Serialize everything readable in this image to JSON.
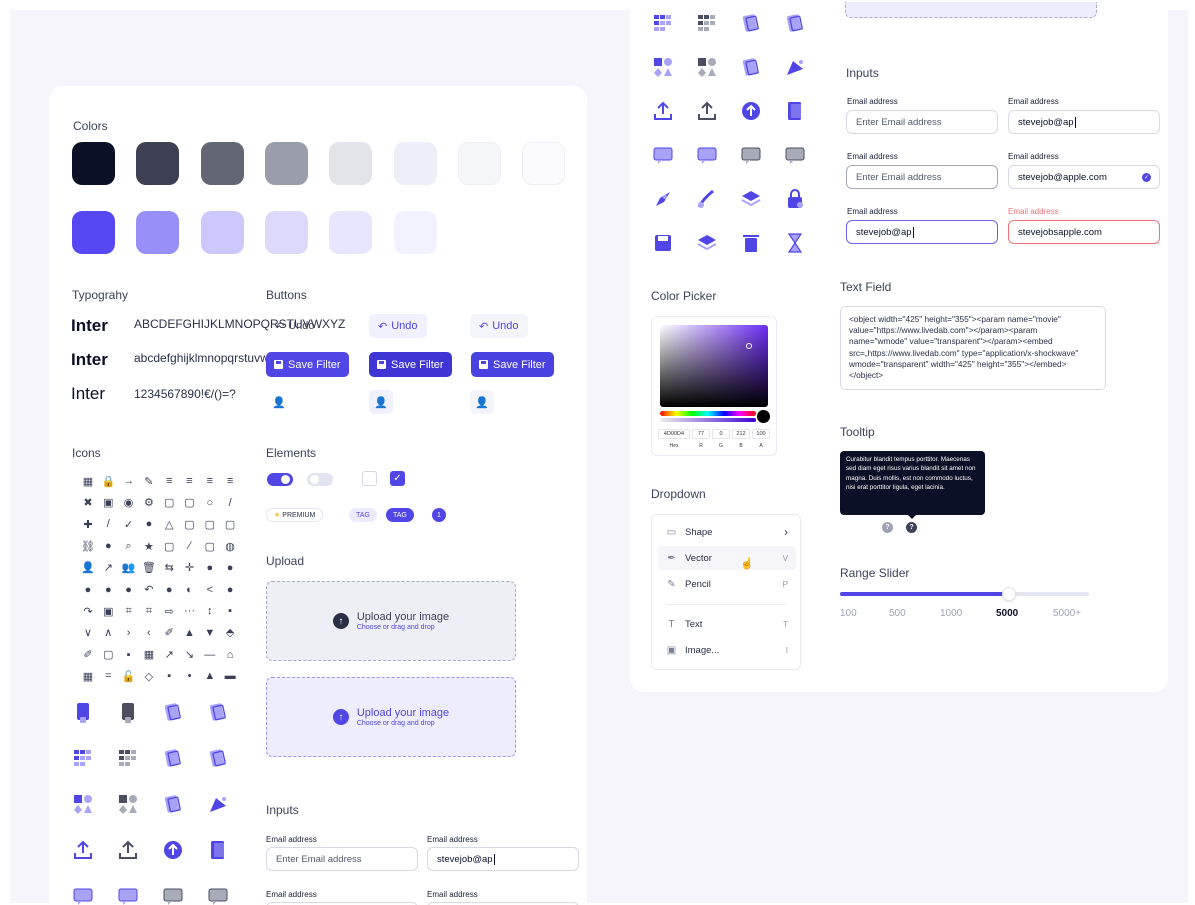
{
  "colors": {
    "title": "Colors",
    "row1": [
      "#0b1026",
      "#3c4052",
      "#626675",
      "#9a9dab",
      "#e2e4ea",
      "#eceff6",
      "#f5f6fa",
      "#fbfbfd"
    ],
    "row2": [
      "#5548f2",
      "#988ff8",
      "#cdc8fc",
      "#ddd9fd",
      "#e8e6fe",
      "#f2f1ff"
    ]
  },
  "typography": {
    "title": "Typograhy",
    "samples": [
      {
        "font": "Inter",
        "text": "ABCDEFGHIJKLMNOPQRSTUVWXYZ"
      },
      {
        "font": "Inter",
        "text": "abcdefghijklmnopqrstuvwxyz"
      },
      {
        "font": "Inter",
        "text": "1234567890!€/()=?"
      }
    ]
  },
  "buttons": {
    "title": "Buttons",
    "undo_label": "Undo",
    "save_label": "Save Filter"
  },
  "icons": {
    "title": "Icons"
  },
  "elements": {
    "title": "Elements",
    "premium": "PREMIUM",
    "tag": "TAG",
    "count": "1"
  },
  "upload": {
    "title": "Upload",
    "heading": "Upload your image",
    "sub": "Choose or drag and drop"
  },
  "inputs": {
    "title": "Inputs",
    "label": "Email address",
    "placeholder": "Enter Email address",
    "partial": "stevejob@ap",
    "valid": "stevejob@apple.com",
    "error_value": "stevejobsapple.com"
  },
  "color_picker": {
    "title": "Color Picker",
    "hex": "4D00D4",
    "r": "77",
    "g": "0",
    "b": "212",
    "a": "100",
    "labels": [
      "Hex",
      "R",
      "G",
      "B",
      "A"
    ]
  },
  "dropdown": {
    "title": "Dropdown",
    "items": [
      {
        "label": "Shape",
        "right": "›"
      },
      {
        "label": "Vector",
        "right": "V"
      },
      {
        "label": "Pencil",
        "right": "P"
      },
      {
        "label": "Text",
        "right": "T"
      },
      {
        "label": "Image...",
        "right": "I"
      }
    ]
  },
  "text_field": {
    "title": "Text Field",
    "value": "<object width=\"425\" height=\"355\"><param name=\"movie\" value=\"https://www.livedab.com\"></param><param name=\"wmode\" value=\"transparent\"></param><embed src=„https://www.livedab.com\" type=\"application/x-shockwave\" wmode=\"transparent\" width=\"425\" height=\"355\"></embed></object>"
  },
  "tooltip": {
    "title": "Tooltip",
    "text": "Curabitur blandit tempus porttitor. Maecenas sed diam eget risus varius blandit sit amet non magna. Duis mollis, est non commodo luctus, nisi erat porttitor ligula, eget lacinia."
  },
  "range_slider": {
    "title": "Range Slider",
    "ticks": [
      "100",
      "500",
      "1000",
      "5000",
      "5000+"
    ],
    "selected": "5000",
    "value_fraction": 0.68
  },
  "accent": "#4f46e5"
}
